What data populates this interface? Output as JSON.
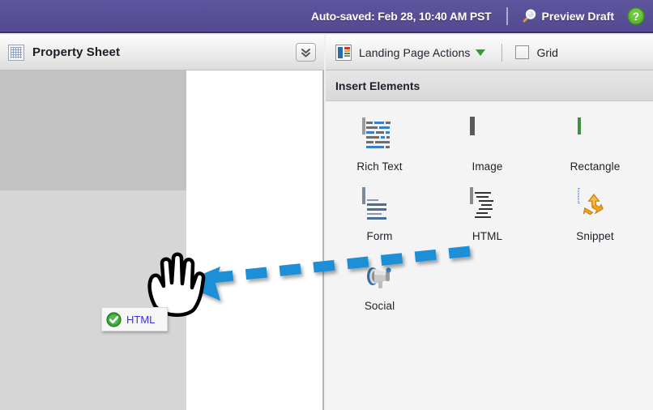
{
  "topbar": {
    "autosave_text": "Auto-saved: Feb 28, 10:40 AM PST",
    "preview_label": "Preview Draft",
    "preview_icon": "magnifier-icon",
    "help_icon": "help-question-icon",
    "separator": "|",
    "bg_color": "#594f97",
    "text_color": "#ffffff"
  },
  "left_panel": {
    "title": "Property Sheet",
    "title_icon": "grid-sheet-icon",
    "collapse_icon": "double-chevron-down-icon"
  },
  "right_panel": {
    "toolbar": {
      "actions_label": "Landing Page Actions",
      "actions_icon": "landing-page-icon",
      "dropdown_icon": "triangle-down-icon",
      "dropdown_color": "#2e9e2e",
      "grid_label": "Grid",
      "grid_checked": false
    },
    "section_title": "Insert Elements",
    "elements": [
      {
        "label": "Rich Text",
        "icon": "rich-text-icon"
      },
      {
        "label": "Image",
        "icon": "image-icon"
      },
      {
        "label": "Rectangle",
        "icon": "rectangle-icon"
      },
      {
        "label": "Form",
        "icon": "form-icon"
      },
      {
        "label": "HTML",
        "icon": "html-icon"
      },
      {
        "label": "Snippet",
        "icon": "snippet-icon"
      },
      {
        "label": "Social",
        "icon": "social-megaphone-icon"
      }
    ]
  },
  "annotation": {
    "arrow_color": "#1f8fd6",
    "arrow_style": "dashed-arrow-pointing-left",
    "cursor_icon": "grabbing-hand-cursor"
  },
  "drag_ghost": {
    "label": "HTML",
    "status_icon": "green-check-circle-icon",
    "label_color": "#3a2fe0"
  }
}
